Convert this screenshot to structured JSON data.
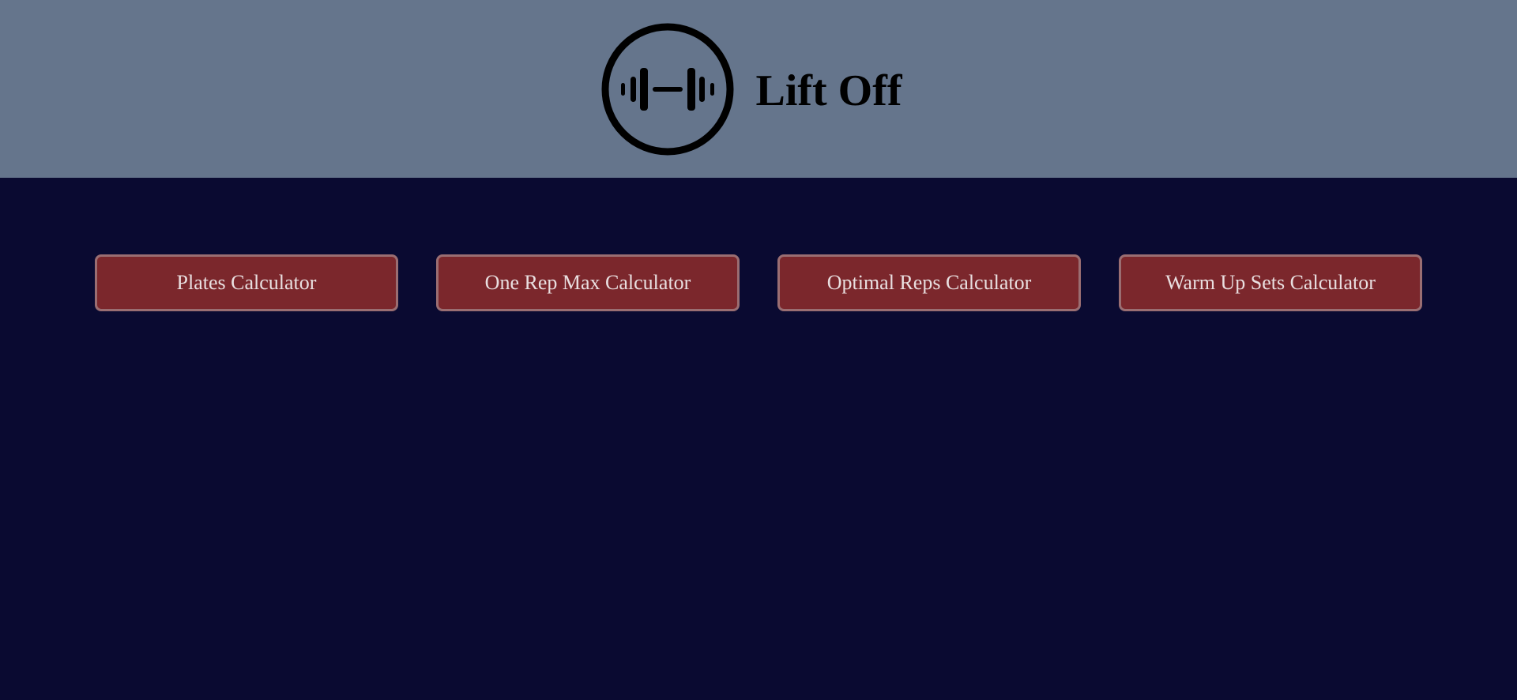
{
  "app": {
    "title": "Lift Off",
    "logo_icon": "barbell-icon"
  },
  "colors": {
    "header_bg": "#65758c",
    "page_bg": "#0a0a31",
    "button_bg": "#7b272c",
    "button_border": "#9a6e72",
    "button_text": "#e9dfe0"
  },
  "nav": {
    "buttons": [
      {
        "label": "Plates Calculator"
      },
      {
        "label": "One Rep Max Calculator"
      },
      {
        "label": "Optimal Reps Calculator"
      },
      {
        "label": "Warm Up Sets Calculator"
      }
    ]
  }
}
